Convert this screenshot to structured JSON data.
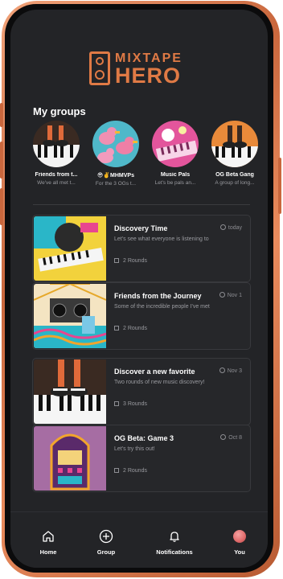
{
  "app": {
    "logo_top": "MIXTAPE",
    "logo_bottom": "HERO",
    "accent_color": "#e07a45"
  },
  "groups_section": {
    "title": "My groups",
    "groups": [
      {
        "name": "Friends from t...",
        "desc": "We've all met t...",
        "art": "piano-feet"
      },
      {
        "name": "😎✌️MHMVPs",
        "desc": "For the 3 OGs t...",
        "art": "rubber-ducks"
      },
      {
        "name": "Music Pals",
        "desc": "Let's be pals an...",
        "art": "pink-keyboard"
      },
      {
        "name": "OG Beta Gang",
        "desc": "A group of long...",
        "art": "piano-feet-orange"
      }
    ]
  },
  "games": [
    {
      "title": "Discovery Time",
      "date": "today",
      "desc": "Let's see what everyone is listening to",
      "rounds": "2 Rounds",
      "art": "keyboard-collage"
    },
    {
      "title": "Friends from the Journey",
      "date": "Nov 1",
      "desc": "Some of the incredible people I've met",
      "rounds": "2 Rounds",
      "art": "boombox"
    },
    {
      "title": "Discover a new favorite",
      "date": "Nov 3",
      "desc": "Two rounds of new music discovery!",
      "rounds": "3 Rounds",
      "art": "piano-feet"
    },
    {
      "title": "OG Beta: Game 3",
      "date": "Oct 8",
      "desc": "Let's try this out!",
      "rounds": "2 Rounds",
      "art": "jukebox"
    }
  ],
  "nav": {
    "items": [
      {
        "label": "Home",
        "icon": "home-icon"
      },
      {
        "label": "Group",
        "icon": "plus-circle-icon"
      },
      {
        "label": "Notifications",
        "icon": "bell-icon"
      },
      {
        "label": "You",
        "icon": "profile-avatar"
      }
    ]
  }
}
